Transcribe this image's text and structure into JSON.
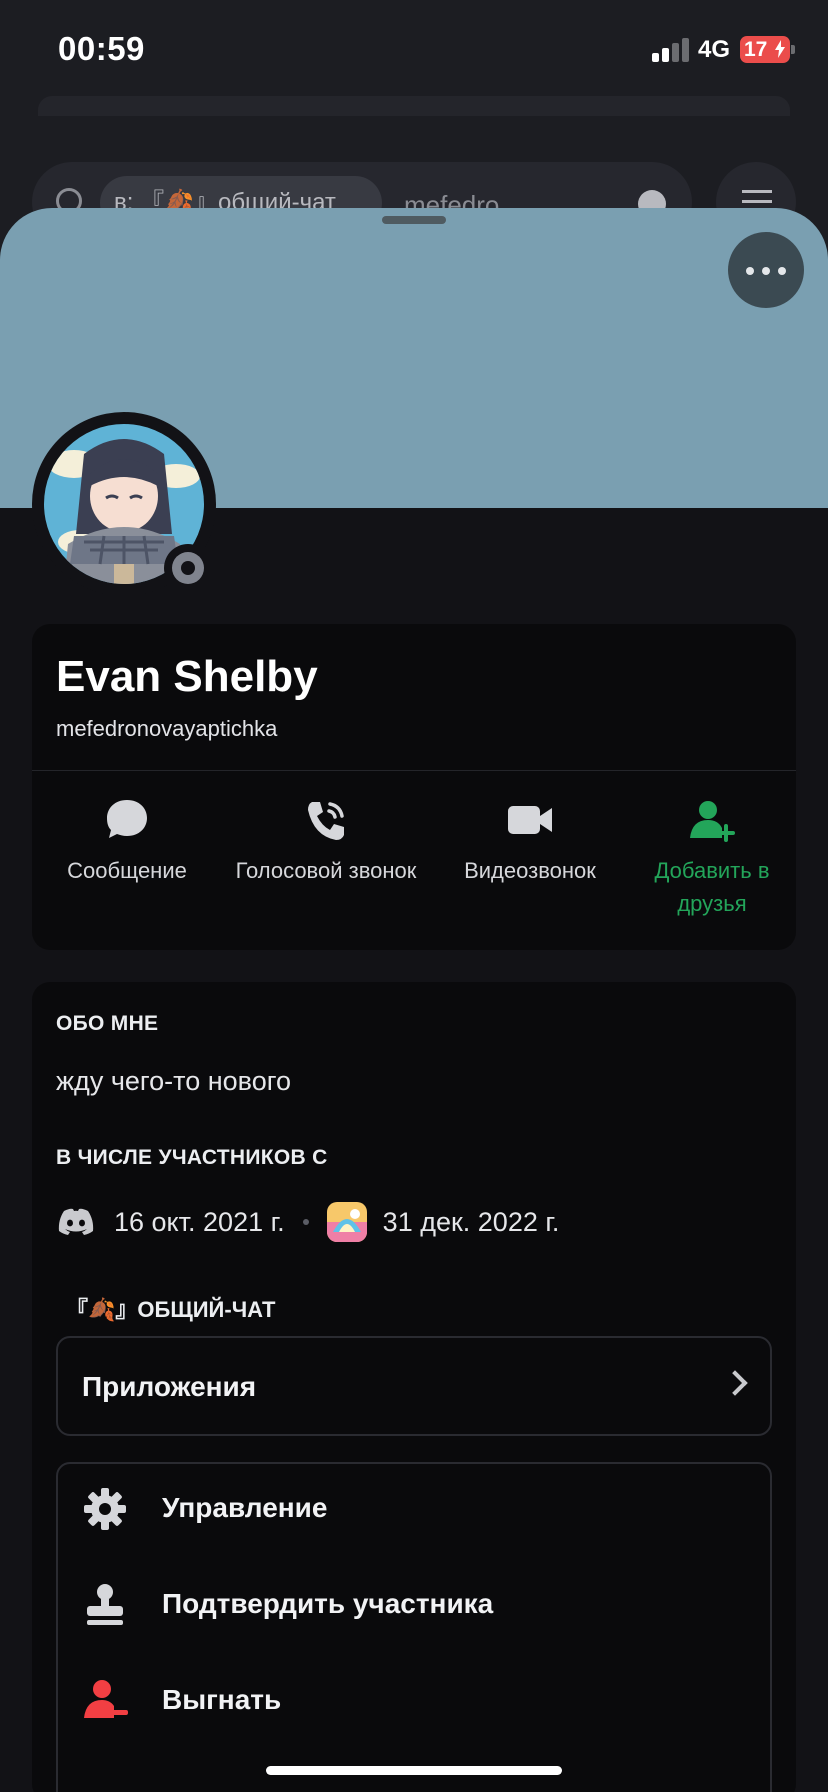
{
  "status_bar": {
    "time": "00:59",
    "network": "4G",
    "battery": "17"
  },
  "background": {
    "search_chip": "в: 『🍂』общий-чат",
    "search_query": "mefedro"
  },
  "profile": {
    "display_name": "Evan Shelby",
    "username": "mefedronovayaptichka",
    "online_status": "offline",
    "banner_color": "#7a9fb1"
  },
  "actions": [
    {
      "label": "Сообщение",
      "icon": "message-icon"
    },
    {
      "label": "Голосовой звонок",
      "icon": "voice-call-icon"
    },
    {
      "label": "Видеозвонок",
      "icon": "video-call-icon"
    },
    {
      "label": "Добавить в друзья",
      "icon": "add-friend-icon",
      "color": "#23a55a"
    }
  ],
  "about": {
    "heading": "ОБО МНЕ",
    "text": "жду чего-то нового"
  },
  "member_since": {
    "heading": "В ЧИСЛЕ УЧАСТНИКОВ С",
    "discord_date": "16 окт. 2021 г.",
    "server_date": "31 дек. 2022 г."
  },
  "server": {
    "name": "『🍂』ОБЩИЙ-ЧАТ"
  },
  "apps": {
    "label": "Приложения"
  },
  "menu": [
    {
      "label": "Управление",
      "icon": "gear-icon"
    },
    {
      "label": "Подтвердить участника",
      "icon": "stamp-icon"
    },
    {
      "label": "Выгнать",
      "icon": "kick-user-icon",
      "color": "#f23f43"
    }
  ]
}
